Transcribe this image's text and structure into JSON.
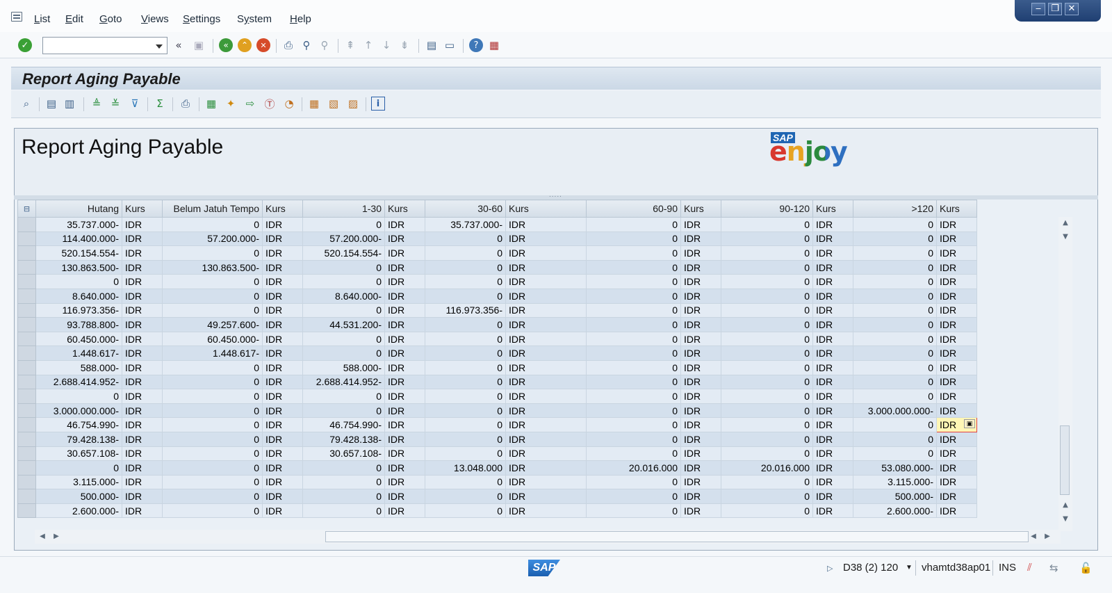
{
  "menu": [
    "List",
    "Edit",
    "Goto",
    "Views",
    "Settings",
    "System",
    "Help"
  ],
  "menu_hotkeys": [
    "L",
    "E",
    "G",
    "V",
    "S",
    "y",
    "H"
  ],
  "window_controls": [
    "minimize",
    "restore",
    "close"
  ],
  "command_field": {
    "value": ""
  },
  "title": "Report Aging Payable",
  "header": {
    "title": "Report Aging Payable",
    "logo_sap": "SAP",
    "logo_text": "enjoy"
  },
  "grid": {
    "columns": [
      "Hutang",
      "Kurs",
      "Belum Jatuh Tempo",
      "Kurs",
      "1-30",
      "Kurs",
      "30-60",
      "Kurs",
      "60-90",
      "Kurs",
      "90-120",
      "Kurs",
      ">120",
      "Kurs"
    ],
    "rows": [
      [
        "35.737.000-",
        "IDR",
        "0",
        "IDR",
        "0",
        "IDR",
        "35.737.000-",
        "IDR",
        "0",
        "IDR",
        "0",
        "IDR",
        "0",
        "IDR"
      ],
      [
        "114.400.000-",
        "IDR",
        "57.200.000-",
        "IDR",
        "57.200.000-",
        "IDR",
        "0",
        "IDR",
        "0",
        "IDR",
        "0",
        "IDR",
        "0",
        "IDR"
      ],
      [
        "520.154.554-",
        "IDR",
        "0",
        "IDR",
        "520.154.554-",
        "IDR",
        "0",
        "IDR",
        "0",
        "IDR",
        "0",
        "IDR",
        "0",
        "IDR"
      ],
      [
        "130.863.500-",
        "IDR",
        "130.863.500-",
        "IDR",
        "0",
        "IDR",
        "0",
        "IDR",
        "0",
        "IDR",
        "0",
        "IDR",
        "0",
        "IDR"
      ],
      [
        "0",
        "IDR",
        "0",
        "IDR",
        "0",
        "IDR",
        "0",
        "IDR",
        "0",
        "IDR",
        "0",
        "IDR",
        "0",
        "IDR"
      ],
      [
        "8.640.000-",
        "IDR",
        "0",
        "IDR",
        "8.640.000-",
        "IDR",
        "0",
        "IDR",
        "0",
        "IDR",
        "0",
        "IDR",
        "0",
        "IDR"
      ],
      [
        "116.973.356-",
        "IDR",
        "0",
        "IDR",
        "0",
        "IDR",
        "116.973.356-",
        "IDR",
        "0",
        "IDR",
        "0",
        "IDR",
        "0",
        "IDR"
      ],
      [
        "93.788.800-",
        "IDR",
        "49.257.600-",
        "IDR",
        "44.531.200-",
        "IDR",
        "0",
        "IDR",
        "0",
        "IDR",
        "0",
        "IDR",
        "0",
        "IDR"
      ],
      [
        "60.450.000-",
        "IDR",
        "60.450.000-",
        "IDR",
        "0",
        "IDR",
        "0",
        "IDR",
        "0",
        "IDR",
        "0",
        "IDR",
        "0",
        "IDR"
      ],
      [
        "1.448.617-",
        "IDR",
        "1.448.617-",
        "IDR",
        "0",
        "IDR",
        "0",
        "IDR",
        "0",
        "IDR",
        "0",
        "IDR",
        "0",
        "IDR"
      ],
      [
        "588.000-",
        "IDR",
        "0",
        "IDR",
        "588.000-",
        "IDR",
        "0",
        "IDR",
        "0",
        "IDR",
        "0",
        "IDR",
        "0",
        "IDR"
      ],
      [
        "2.688.414.952-",
        "IDR",
        "0",
        "IDR",
        "2.688.414.952-",
        "IDR",
        "0",
        "IDR",
        "0",
        "IDR",
        "0",
        "IDR",
        "0",
        "IDR"
      ],
      [
        "0",
        "IDR",
        "0",
        "IDR",
        "0",
        "IDR",
        "0",
        "IDR",
        "0",
        "IDR",
        "0",
        "IDR",
        "0",
        "IDR"
      ],
      [
        "3.000.000.000-",
        "IDR",
        "0",
        "IDR",
        "0",
        "IDR",
        "0",
        "IDR",
        "0",
        "IDR",
        "0",
        "IDR",
        "3.000.000.000-",
        "IDR"
      ],
      [
        "46.754.990-",
        "IDR",
        "0",
        "IDR",
        "46.754.990-",
        "IDR",
        "0",
        "IDR",
        "0",
        "IDR",
        "0",
        "IDR",
        "0",
        "IDR"
      ],
      [
        "79.428.138-",
        "IDR",
        "0",
        "IDR",
        "79.428.138-",
        "IDR",
        "0",
        "IDR",
        "0",
        "IDR",
        "0",
        "IDR",
        "0",
        "IDR"
      ],
      [
        "30.657.108-",
        "IDR",
        "0",
        "IDR",
        "30.657.108-",
        "IDR",
        "0",
        "IDR",
        "0",
        "IDR",
        "0",
        "IDR",
        "0",
        "IDR"
      ],
      [
        "0",
        "IDR",
        "0",
        "IDR",
        "0",
        "IDR",
        "13.048.000",
        "IDR",
        "20.016.000",
        "IDR",
        "20.016.000",
        "IDR",
        "53.080.000-",
        "IDR"
      ],
      [
        "3.115.000-",
        "IDR",
        "0",
        "IDR",
        "0",
        "IDR",
        "0",
        "IDR",
        "0",
        "IDR",
        "0",
        "IDR",
        "3.115.000-",
        "IDR"
      ],
      [
        "500.000-",
        "IDR",
        "0",
        "IDR",
        "0",
        "IDR",
        "0",
        "IDR",
        "0",
        "IDR",
        "0",
        "IDR",
        "500.000-",
        "IDR"
      ],
      [
        "2.600.000-",
        "IDR",
        "0",
        "IDR",
        "0",
        "IDR",
        "0",
        "IDR",
        "0",
        "IDR",
        "0",
        "IDR",
        "2.600.000-",
        "IDR"
      ]
    ],
    "active_cell": {
      "row": 14,
      "col": 13
    }
  },
  "status": {
    "logo": "SAP",
    "system": "D38 (2) 120",
    "server": "vhamtd38ap01",
    "mode": "INS"
  },
  "colors": {
    "title_bg": "#d6e1ec",
    "row_odd": "#e3ebf4",
    "row_even": "#d4e0ed",
    "active_cell": "#fff6b5",
    "window_controls": "#2c4c80"
  }
}
